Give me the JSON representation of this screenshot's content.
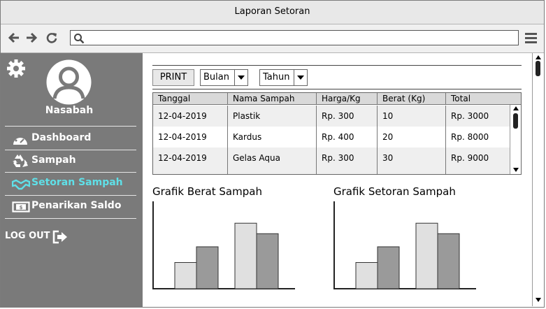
{
  "window": {
    "title": "Laporan Setoran"
  },
  "browser": {
    "url": ""
  },
  "sidebar": {
    "profile_name": "Nasabah",
    "items": [
      {
        "label": "Dashboard",
        "active": false
      },
      {
        "label": "Sampah",
        "active": false
      },
      {
        "label": "Setoran Sampah",
        "active": true
      },
      {
        "label": "Penarikan Saldo",
        "active": false
      }
    ],
    "logout_label": "LOG OUT",
    "active_color": "#5fe0e8"
  },
  "controls": {
    "print_label": "PRINT",
    "month_select": "Bulan",
    "year_select": "Tahun"
  },
  "table": {
    "headers": [
      "Tanggal",
      "Nama Sampah",
      "Harga/Kg",
      "Berat (Kg)",
      "Total"
    ],
    "rows": [
      [
        "12-04-2019",
        "Plastik",
        "Rp. 300",
        "10",
        "Rp. 3000"
      ],
      [
        "12-04-2019",
        "Kardus",
        "Rp. 400",
        "20",
        "Rp. 8000"
      ],
      [
        "12-04-2019",
        "Gelas Aqua",
        "Rp. 300",
        "30",
        "Rp. 9000"
      ]
    ]
  },
  "charts": {
    "berat_title": "Grafik Berat Sampah",
    "setoran_title": "Grafik Setoran Sampah"
  },
  "chart_data": [
    {
      "type": "bar",
      "title": "Grafik Berat Sampah",
      "categories": [
        "",
        ""
      ],
      "series": [
        {
          "values": [
            30,
            75
          ]
        },
        {
          "values": [
            48,
            63
          ]
        }
      ],
      "ylim": [
        0,
        100
      ]
    },
    {
      "type": "bar",
      "title": "Grafik Setoran Sampah",
      "categories": [
        "",
        ""
      ],
      "series": [
        {
          "values": [
            30,
            75
          ]
        },
        {
          "values": [
            48,
            63
          ]
        }
      ],
      "ylim": [
        0,
        100
      ]
    }
  ]
}
